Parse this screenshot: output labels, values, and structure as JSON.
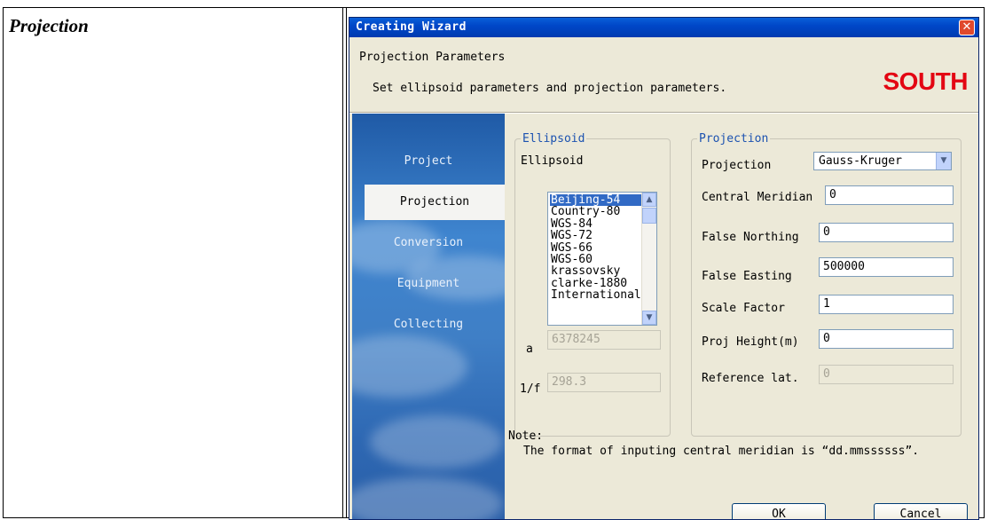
{
  "document": {
    "row_label": "Projection"
  },
  "window": {
    "title": "Creating Wizard",
    "close_glyph": "✕"
  },
  "header": {
    "title": "Projection Parameters",
    "subtitle": "Set ellipsoid parameters and projection parameters.",
    "logo": "SOUTH"
  },
  "sidebar": {
    "items": [
      {
        "label": "Project",
        "active": false
      },
      {
        "label": "Projection",
        "active": true
      },
      {
        "label": "Conversion",
        "active": false
      },
      {
        "label": "Equipment",
        "active": false
      },
      {
        "label": "Collecting",
        "active": false
      }
    ]
  },
  "ellipsoid": {
    "group_title": "Ellipsoid",
    "label": "Ellipsoid",
    "options": [
      "Beijing-54",
      "Country-80",
      "WGS-84",
      "WGS-72",
      "WGS-66",
      "WGS-60",
      "krassovsky",
      "clarke-1880",
      "International"
    ],
    "selected": "Beijing-54",
    "a_label": "a",
    "a_value": "6378245",
    "f_label": "1/f",
    "f_value": "298.3"
  },
  "projection": {
    "group_title": "Projection",
    "type_label": "Projection",
    "type_value": "Gauss-Kruger",
    "central_meridian_label": "Central Meridian",
    "central_meridian_value": "0",
    "false_northing_label": "False Northing",
    "false_northing_value": "0",
    "false_easting_label": "False Easting",
    "false_easting_value": "500000",
    "scale_factor_label": "Scale Factor",
    "scale_factor_value": "1",
    "proj_height_label": "Proj Height(m)",
    "proj_height_value": "0",
    "reference_lat_label": "Reference lat.",
    "reference_lat_value": "0"
  },
  "note": {
    "title": "Note:",
    "text": "The format of inputing central meridian is “dd.mmssssss”."
  },
  "buttons": {
    "ok": "OK",
    "cancel": "Cancel"
  },
  "colors": {
    "title_bar": "#0047c8",
    "accent_legend": "#1c52b0",
    "logo": "#e30613",
    "selection": "#316ac5"
  }
}
